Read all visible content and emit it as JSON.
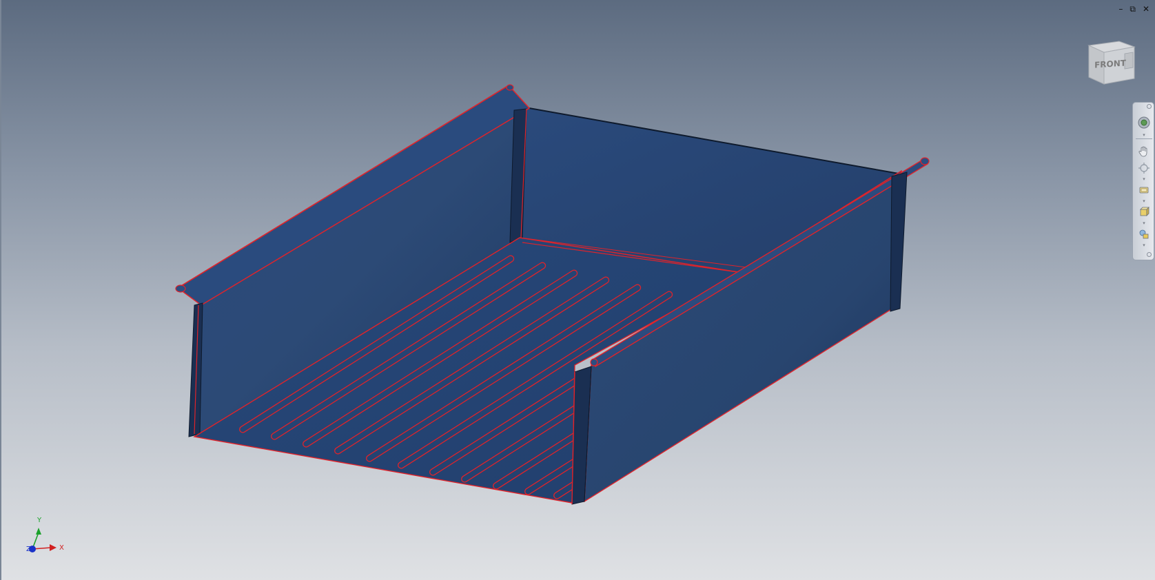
{
  "window": {
    "minimize_glyph": "–",
    "restore_glyph": "⧉",
    "close_glyph": "✕"
  },
  "viewcube": {
    "face_label": "FRONT"
  },
  "navbar": {
    "items": [
      {
        "icon": "steering-wheel-icon"
      },
      {
        "icon": "pan-icon"
      },
      {
        "icon": "zoom-icon"
      },
      {
        "icon": "orbit-icon"
      },
      {
        "icon": "look-at-icon"
      },
      {
        "icon": "view-face-icon"
      },
      {
        "icon": "visual-style-icon"
      }
    ]
  },
  "triad": {
    "x_label": "X",
    "y_label": "Y",
    "z_label": "Z"
  },
  "colors": {
    "part_fill": "#1f3a66",
    "edge_highlight": "#e0232a",
    "axis_x": "#d12020",
    "axis_y": "#1aa12a",
    "axis_z": "#1a32c8"
  }
}
